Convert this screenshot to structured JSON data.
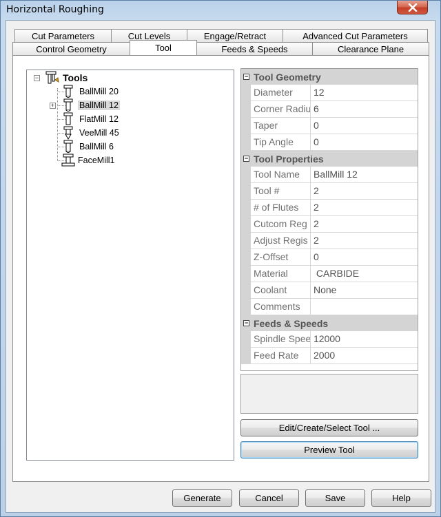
{
  "window": {
    "title": "Horizontal Roughing"
  },
  "tabs": {
    "row1": [
      "Cut Parameters",
      "Cut Levels",
      "Engage/Retract",
      "Advanced Cut Parameters"
    ],
    "row2": [
      "Control Geometry",
      "Tool",
      "Feeds & Speeds",
      "Clearance Plane"
    ],
    "active": "Tool"
  },
  "tree": {
    "root": "Tools",
    "items": [
      "BallMill 20",
      "BallMill 12",
      "FlatMill 12",
      "VeeMill 45",
      "BallMill 6",
      "FaceMill1"
    ],
    "selected": "BallMill 12"
  },
  "properties": {
    "tool_geometry": {
      "title": "Tool Geometry",
      "rows": [
        {
          "name": "Diameter",
          "value": "12"
        },
        {
          "name": "Corner Radius",
          "value": "6"
        },
        {
          "name": "Taper",
          "value": "0"
        },
        {
          "name": "Tip Angle",
          "value": "0"
        }
      ]
    },
    "tool_properties": {
      "title": "Tool Properties",
      "rows": [
        {
          "name": "Tool Name",
          "value": "BallMill 12"
        },
        {
          "name": "Tool #",
          "value": "2"
        },
        {
          "name": "# of Flutes",
          "value": "2"
        },
        {
          "name": "Cutcom Reg",
          "value": "2"
        },
        {
          "name": "Adjust Regis",
          "value": "2"
        },
        {
          "name": "Z-Offset",
          "value": "0"
        },
        {
          "name": "Material",
          "value": " CARBIDE"
        },
        {
          "name": "Coolant",
          "value": "None"
        },
        {
          "name": "Comments",
          "value": ""
        }
      ]
    },
    "feeds_speeds": {
      "title": "Feeds & Speeds",
      "rows": [
        {
          "name": "Spindle Speed",
          "value": "12000"
        },
        {
          "name": "Feed Rate",
          "value": "2000"
        }
      ]
    }
  },
  "buttons": {
    "edit_tool": "Edit/Create/Select Tool ...",
    "preview_tool": "Preview Tool",
    "generate": "Generate",
    "cancel": "Cancel",
    "save": "Save",
    "help": "Help"
  }
}
